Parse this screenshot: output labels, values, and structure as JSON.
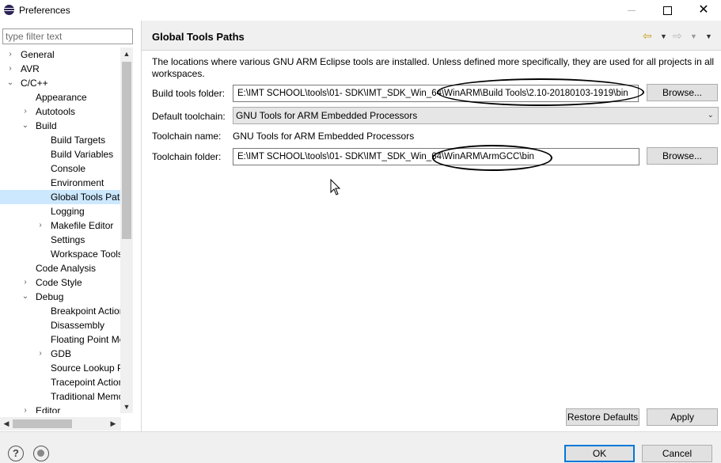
{
  "window": {
    "title": "Preferences",
    "icon": "eclipse-icon"
  },
  "left": {
    "filter_placeholder": "type filter text",
    "tree": [
      {
        "label": "General",
        "indent": 1,
        "twisty": "collapsed"
      },
      {
        "label": "AVR",
        "indent": 1,
        "twisty": "collapsed"
      },
      {
        "label": "C/C++",
        "indent": 1,
        "twisty": "expanded"
      },
      {
        "label": "Appearance",
        "indent": 2,
        "twisty": "none"
      },
      {
        "label": "Autotools",
        "indent": 2,
        "twisty": "collapsed"
      },
      {
        "label": "Build",
        "indent": 2,
        "twisty": "expanded"
      },
      {
        "label": "Build Targets",
        "indent": 3,
        "twisty": "none"
      },
      {
        "label": "Build Variables",
        "indent": 3,
        "twisty": "none"
      },
      {
        "label": "Console",
        "indent": 3,
        "twisty": "none"
      },
      {
        "label": "Environment",
        "indent": 3,
        "twisty": "none"
      },
      {
        "label": "Global Tools Paths",
        "indent": 3,
        "twisty": "none",
        "selected": true
      },
      {
        "label": "Logging",
        "indent": 3,
        "twisty": "none"
      },
      {
        "label": "Makefile Editor",
        "indent": 3,
        "twisty": "collapsed"
      },
      {
        "label": "Settings",
        "indent": 3,
        "twisty": "none"
      },
      {
        "label": "Workspace Tools Paths",
        "indent": 3,
        "twisty": "none"
      },
      {
        "label": "Code Analysis",
        "indent": 2,
        "twisty": "none"
      },
      {
        "label": "Code Style",
        "indent": 2,
        "twisty": "collapsed"
      },
      {
        "label": "Debug",
        "indent": 2,
        "twisty": "expanded"
      },
      {
        "label": "Breakpoint Actions",
        "indent": 3,
        "twisty": "none"
      },
      {
        "label": "Disassembly",
        "indent": 3,
        "twisty": "none"
      },
      {
        "label": "Floating Point Mode",
        "indent": 3,
        "twisty": "none"
      },
      {
        "label": "GDB",
        "indent": 3,
        "twisty": "collapsed"
      },
      {
        "label": "Source Lookup Path",
        "indent": 3,
        "twisty": "none"
      },
      {
        "label": "Tracepoint Actions",
        "indent": 3,
        "twisty": "none"
      },
      {
        "label": "Traditional Memory Rendering",
        "indent": 3,
        "twisty": "none"
      },
      {
        "label": "Editor",
        "indent": 2,
        "twisty": "collapsed"
      }
    ]
  },
  "right": {
    "title": "Global Tools Paths",
    "description": "The locations where various GNU ARM Eclipse tools are installed. Unless defined more specifically, they are used for all projects in all workspaces.",
    "build_tools_folder": {
      "label": "Build tools folder:",
      "value": "E:\\IMT SCHOOL\\tools\\01- SDK\\IMT_SDK_Win_64\\WinARM\\Build Tools\\2.10-20180103-1919\\bin"
    },
    "default_toolchain": {
      "label": "Default toolchain:",
      "value": "GNU Tools for ARM Embedded Processors"
    },
    "toolchain_name": {
      "label": "Toolchain name:",
      "value": "GNU Tools for ARM Embedded Processors"
    },
    "toolchain_folder": {
      "label": "Toolchain folder:",
      "value": "E:\\IMT SCHOOL\\tools\\01- SDK\\IMT_SDK_Win_64\\WinARM\\ArmGCC\\bin"
    },
    "browse_label": "Browse...",
    "restore_defaults_label": "Restore Defaults",
    "apply_label": "Apply"
  },
  "bottom": {
    "ok_label": "OK",
    "cancel_label": "Cancel"
  },
  "colors": {
    "selection": "#cce8ff",
    "back_arrow": "#c89b18",
    "default_button_border": "#0078d7"
  }
}
